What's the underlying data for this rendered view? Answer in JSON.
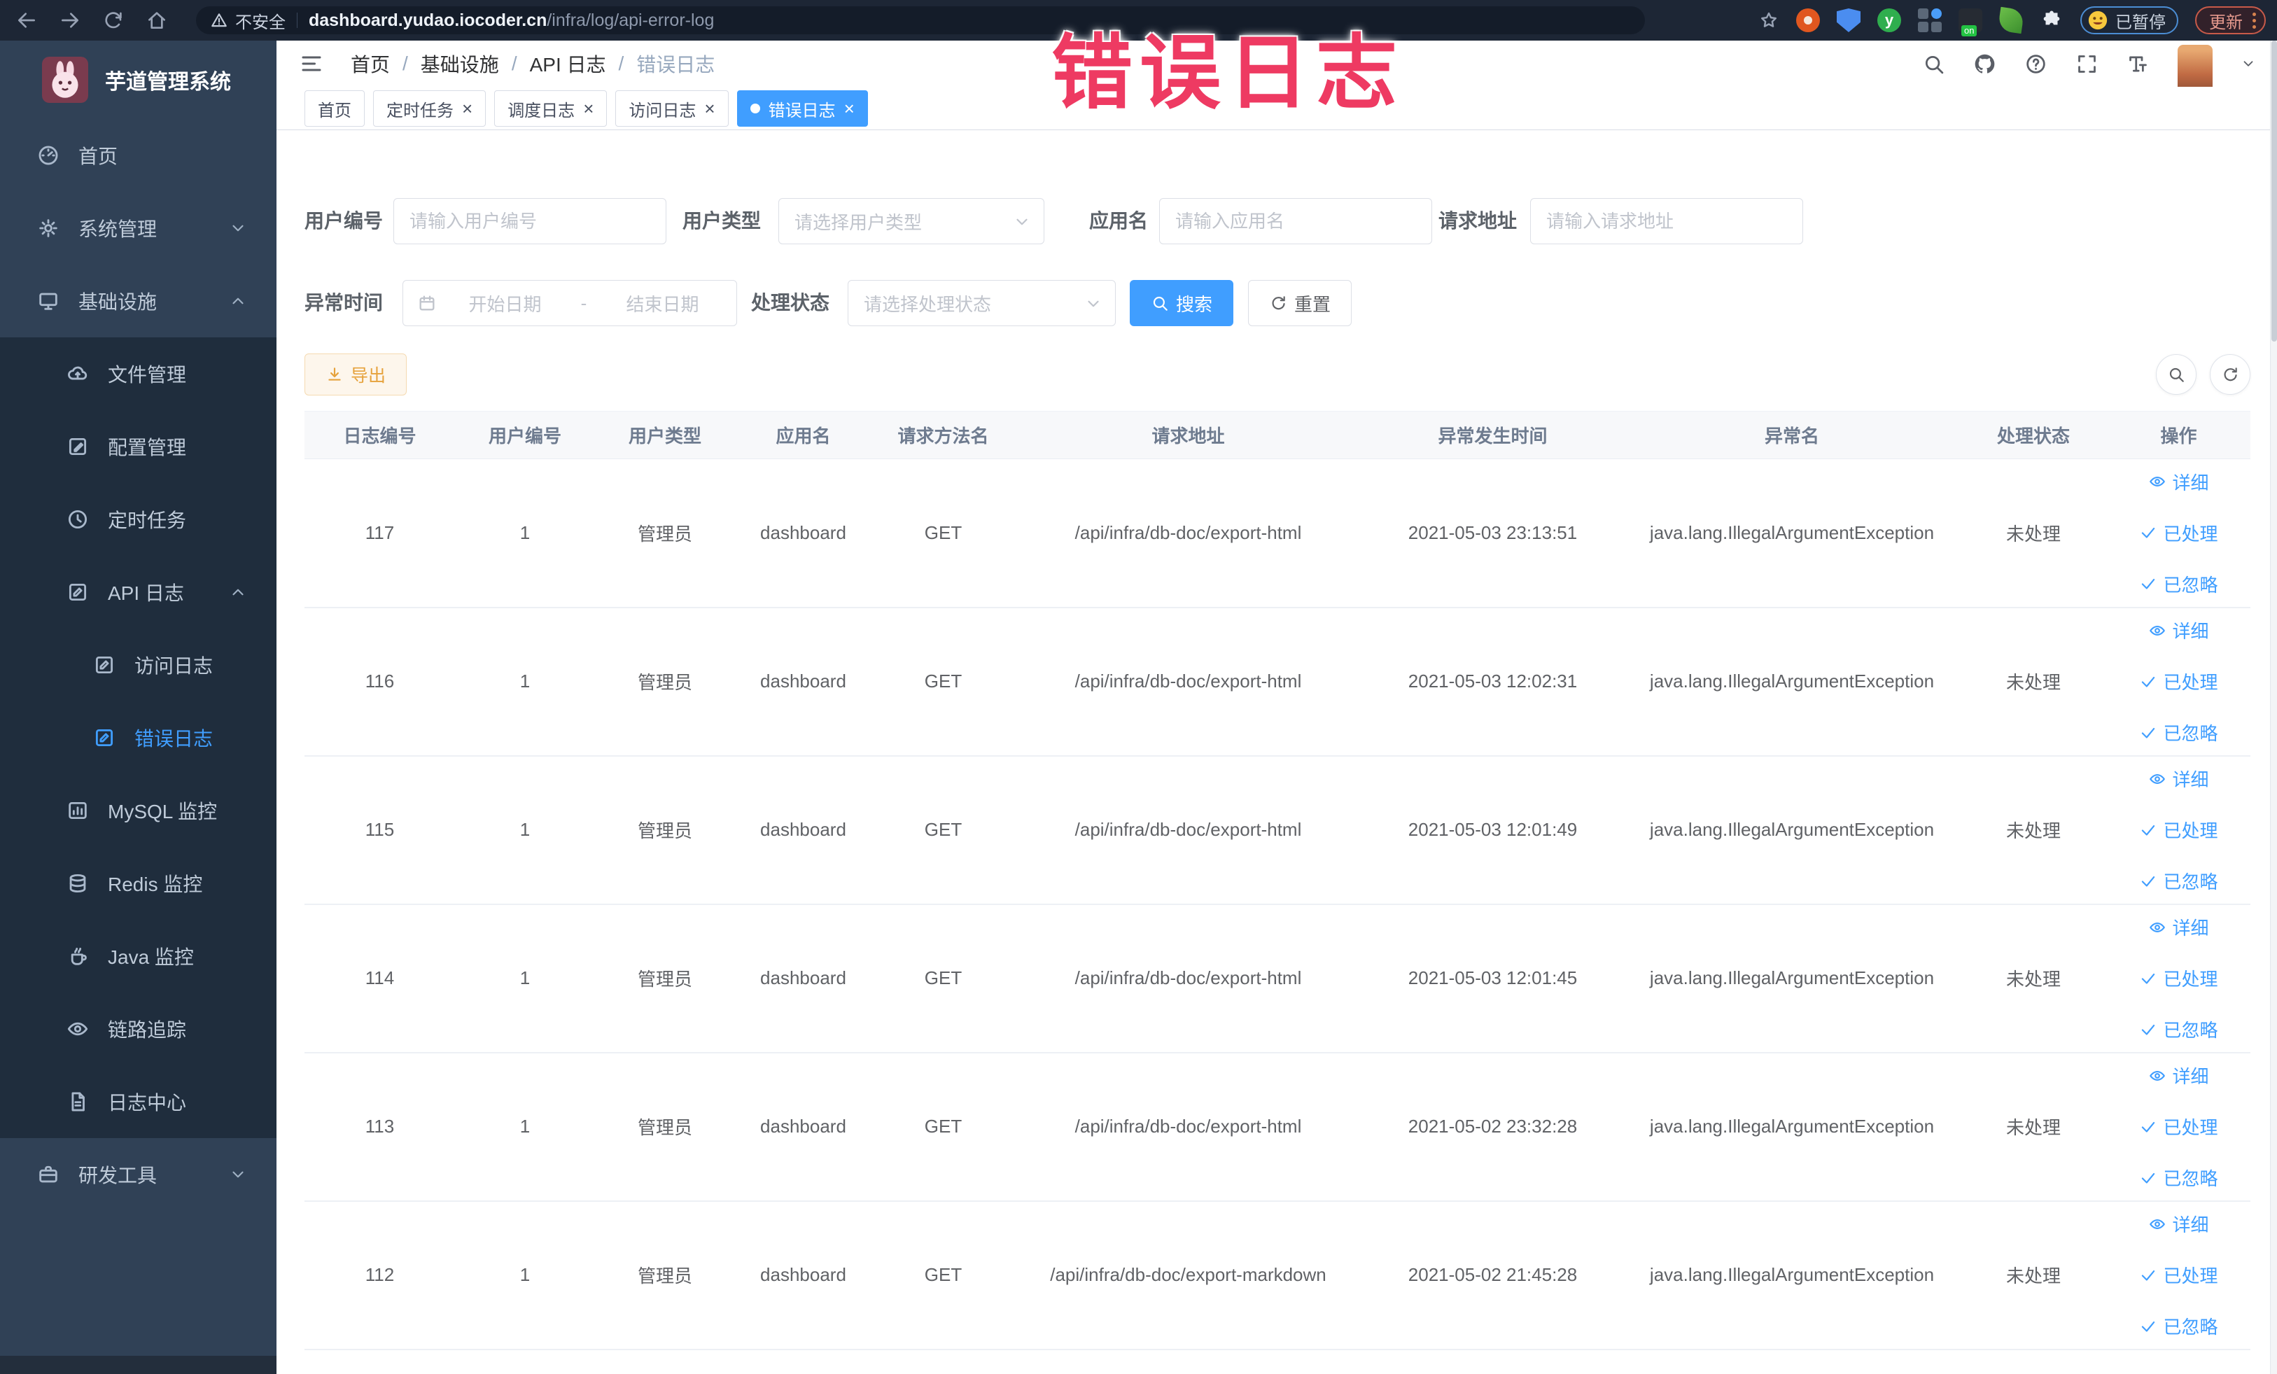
{
  "browser": {
    "security_label": "不安全",
    "url_domain": "dashboard.yudao.iocoder.cn",
    "url_path": "/infra/log/api-error-log",
    "profile_status_label": "已暂停",
    "update_button_label": "更新",
    "extension_icons": [
      "bookmark-star-icon",
      "orange-extension-icon",
      "shield-extension-icon",
      "green-extension-icon",
      "grid-extension-icon",
      "proxy-on-extension-icon",
      "leaf-extension-icon",
      "puzzle-extensions-icon"
    ]
  },
  "annotation": {
    "text": "错误日志",
    "color": "#ee3a62"
  },
  "sidebar": {
    "logo_title": "芋道管理系统",
    "items": [
      {
        "key": "home",
        "label": "首页",
        "icon": "dashboard-icon",
        "glyph": "gauge",
        "level": 0
      },
      {
        "key": "system-management",
        "label": "系统管理",
        "icon": "gear-icon",
        "glyph": "gear",
        "level": 0,
        "chevron": "down"
      },
      {
        "key": "infrastructure",
        "label": "基础设施",
        "icon": "monitor-icon",
        "glyph": "monitor",
        "level": 0,
        "chevron": "up"
      },
      {
        "key": "file-management",
        "label": "文件管理",
        "icon": "cloud-upload-icon",
        "glyph": "cloud",
        "level": 1
      },
      {
        "key": "config-management",
        "label": "配置管理",
        "icon": "edit-icon",
        "glyph": "edit",
        "level": 1
      },
      {
        "key": "scheduled-task",
        "label": "定时任务",
        "icon": "clock-icon",
        "glyph": "clock",
        "level": 1
      },
      {
        "key": "api-log",
        "label": "API 日志",
        "icon": "log-edit-icon",
        "glyph": "logedit",
        "level": 1,
        "chevron": "up"
      },
      {
        "key": "access-log",
        "label": "访问日志",
        "icon": "log-edit-icon",
        "glyph": "logedit",
        "level": 2
      },
      {
        "key": "error-log",
        "label": "错误日志",
        "icon": "log-edit-icon",
        "glyph": "logedit",
        "level": 2,
        "active": true
      },
      {
        "key": "mysql-monitor",
        "label": "MySQL 监控",
        "icon": "chart-icon",
        "glyph": "chart",
        "level": 1
      },
      {
        "key": "redis-monitor",
        "label": "Redis 监控",
        "icon": "database-icon",
        "glyph": "db",
        "level": 1
      },
      {
        "key": "java-monitor",
        "label": "Java 监控",
        "icon": "java-cup-icon",
        "glyph": "java",
        "level": 1
      },
      {
        "key": "trace",
        "label": "链路追踪",
        "icon": "eye-icon",
        "glyph": "eye",
        "level": 1
      },
      {
        "key": "log-center",
        "label": "日志中心",
        "icon": "document-icon",
        "glyph": "doc",
        "level": 1
      },
      {
        "key": "dev-tools",
        "label": "研发工具",
        "icon": "toolbox-icon",
        "glyph": "case",
        "level": 0,
        "chevron": "down"
      }
    ]
  },
  "header": {
    "breadcrumb": [
      {
        "key": "home",
        "label": "首页"
      },
      {
        "key": "infrastructure",
        "label": "基础设施"
      },
      {
        "key": "api-log",
        "label": "API 日志"
      },
      {
        "key": "error-log",
        "label": "错误日志"
      }
    ],
    "toolbar_icons": [
      "search-icon",
      "github-icon",
      "help-icon",
      "fullscreen-icon",
      "font-size-icon",
      "avatar",
      "chevron-down-icon"
    ]
  },
  "tabs": [
    {
      "key": "home",
      "label": "首页",
      "closable": false,
      "active": false
    },
    {
      "key": "scheduled-task",
      "label": "定时任务",
      "closable": true,
      "active": false
    },
    {
      "key": "schedule-log",
      "label": "调度日志",
      "closable": true,
      "active": false
    },
    {
      "key": "access-log",
      "label": "访问日志",
      "closable": true,
      "active": false
    },
    {
      "key": "error-log",
      "label": "错误日志",
      "closable": true,
      "active": true
    }
  ],
  "filters": {
    "user_id": {
      "label": "用户编号",
      "placeholder": "请输入用户编号"
    },
    "user_type": {
      "label": "用户类型",
      "placeholder": "请选择用户类型"
    },
    "app_name": {
      "label": "应用名",
      "placeholder": "请输入应用名"
    },
    "request_url": {
      "label": "请求地址",
      "placeholder": "请输入请求地址"
    },
    "exception_time": {
      "label": "异常时间",
      "start_placeholder": "开始日期",
      "separator": "-",
      "end_placeholder": "结束日期"
    },
    "process_status": {
      "label": "处理状态",
      "placeholder": "请选择处理状态"
    },
    "search_label": "搜索",
    "reset_label": "重置"
  },
  "toolbar": {
    "export_label": "导出"
  },
  "table": {
    "columns": [
      "日志编号",
      "用户编号",
      "用户类型",
      "应用名",
      "请求方法名",
      "请求地址",
      "异常发生时间",
      "异常名",
      "处理状态",
      "操作"
    ],
    "actions": [
      {
        "key": "detail",
        "label": "详细",
        "icon": "eye-icon",
        "glyph": "eye"
      },
      {
        "key": "processed",
        "label": "已处理",
        "icon": "check-icon",
        "glyph": "check"
      },
      {
        "key": "ignored",
        "label": "已忽略",
        "icon": "check-icon",
        "glyph": "check"
      }
    ],
    "rows": [
      {
        "id": "117",
        "user_id": "1",
        "user_type": "管理员",
        "app": "dashboard",
        "method": "GET",
        "url": "/api/infra/db-doc/export-html",
        "time": "2021-05-03 23:13:51",
        "exception": "java.lang.IllegalArgumentException",
        "status": "未处理"
      },
      {
        "id": "116",
        "user_id": "1",
        "user_type": "管理员",
        "app": "dashboard",
        "method": "GET",
        "url": "/api/infra/db-doc/export-html",
        "time": "2021-05-03 12:02:31",
        "exception": "java.lang.IllegalArgumentException",
        "status": "未处理"
      },
      {
        "id": "115",
        "user_id": "1",
        "user_type": "管理员",
        "app": "dashboard",
        "method": "GET",
        "url": "/api/infra/db-doc/export-html",
        "time": "2021-05-03 12:01:49",
        "exception": "java.lang.IllegalArgumentException",
        "status": "未处理"
      },
      {
        "id": "114",
        "user_id": "1",
        "user_type": "管理员",
        "app": "dashboard",
        "method": "GET",
        "url": "/api/infra/db-doc/export-html",
        "time": "2021-05-03 12:01:45",
        "exception": "java.lang.IllegalArgumentException",
        "status": "未处理"
      },
      {
        "id": "113",
        "user_id": "1",
        "user_type": "管理员",
        "app": "dashboard",
        "method": "GET",
        "url": "/api/infra/db-doc/export-html",
        "time": "2021-05-02 23:32:28",
        "exception": "java.lang.IllegalArgumentException",
        "status": "未处理"
      },
      {
        "id": "112",
        "user_id": "1",
        "user_type": "管理员",
        "app": "dashboard",
        "method": "GET",
        "url": "/api/infra/db-doc/export-markdown",
        "time": "2021-05-02 21:45:28",
        "exception": "java.lang.IllegalArgumentException",
        "status": "未处理"
      }
    ]
  }
}
